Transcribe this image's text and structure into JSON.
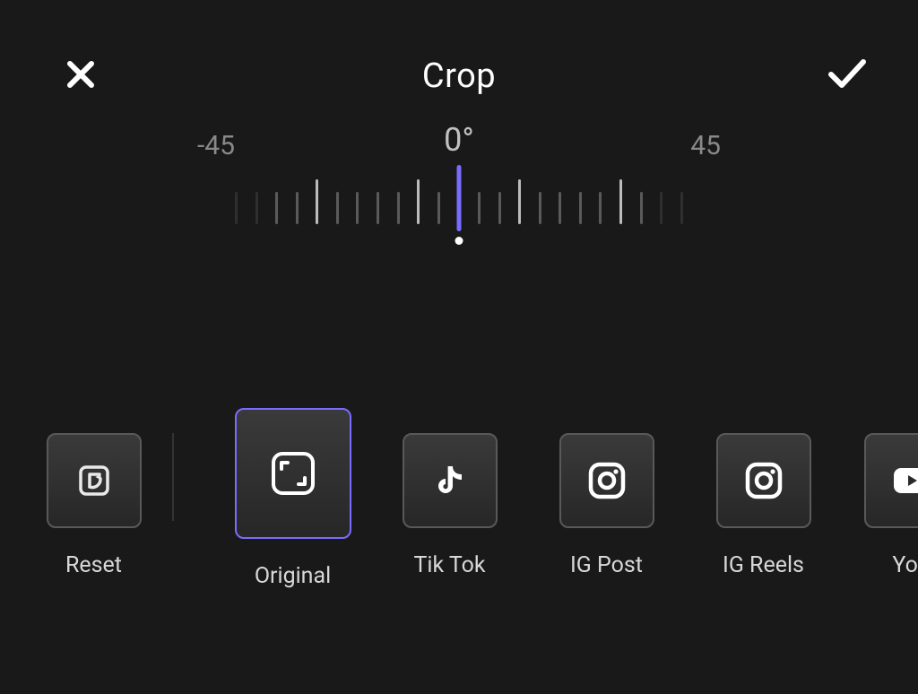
{
  "header": {
    "title": "Crop"
  },
  "rotation": {
    "value_label": "0°",
    "min_label": "-45",
    "max_label": "45"
  },
  "reset": {
    "label": "Reset"
  },
  "presets": [
    {
      "id": "original",
      "label": "Original",
      "icon": "original-icon",
      "active": true
    },
    {
      "id": "tiktok",
      "label": "Tik Tok",
      "icon": "tiktok-icon",
      "active": false
    },
    {
      "id": "igpost",
      "label": "IG Post",
      "icon": "instagram-icon",
      "active": false
    },
    {
      "id": "igreels",
      "label": "IG Reels",
      "icon": "instagram-icon",
      "active": false
    },
    {
      "id": "youtube",
      "label": "You",
      "icon": "youtube-icon",
      "active": false
    }
  ],
  "colors": {
    "accent": "#7a6cff",
    "background": "#191919"
  }
}
